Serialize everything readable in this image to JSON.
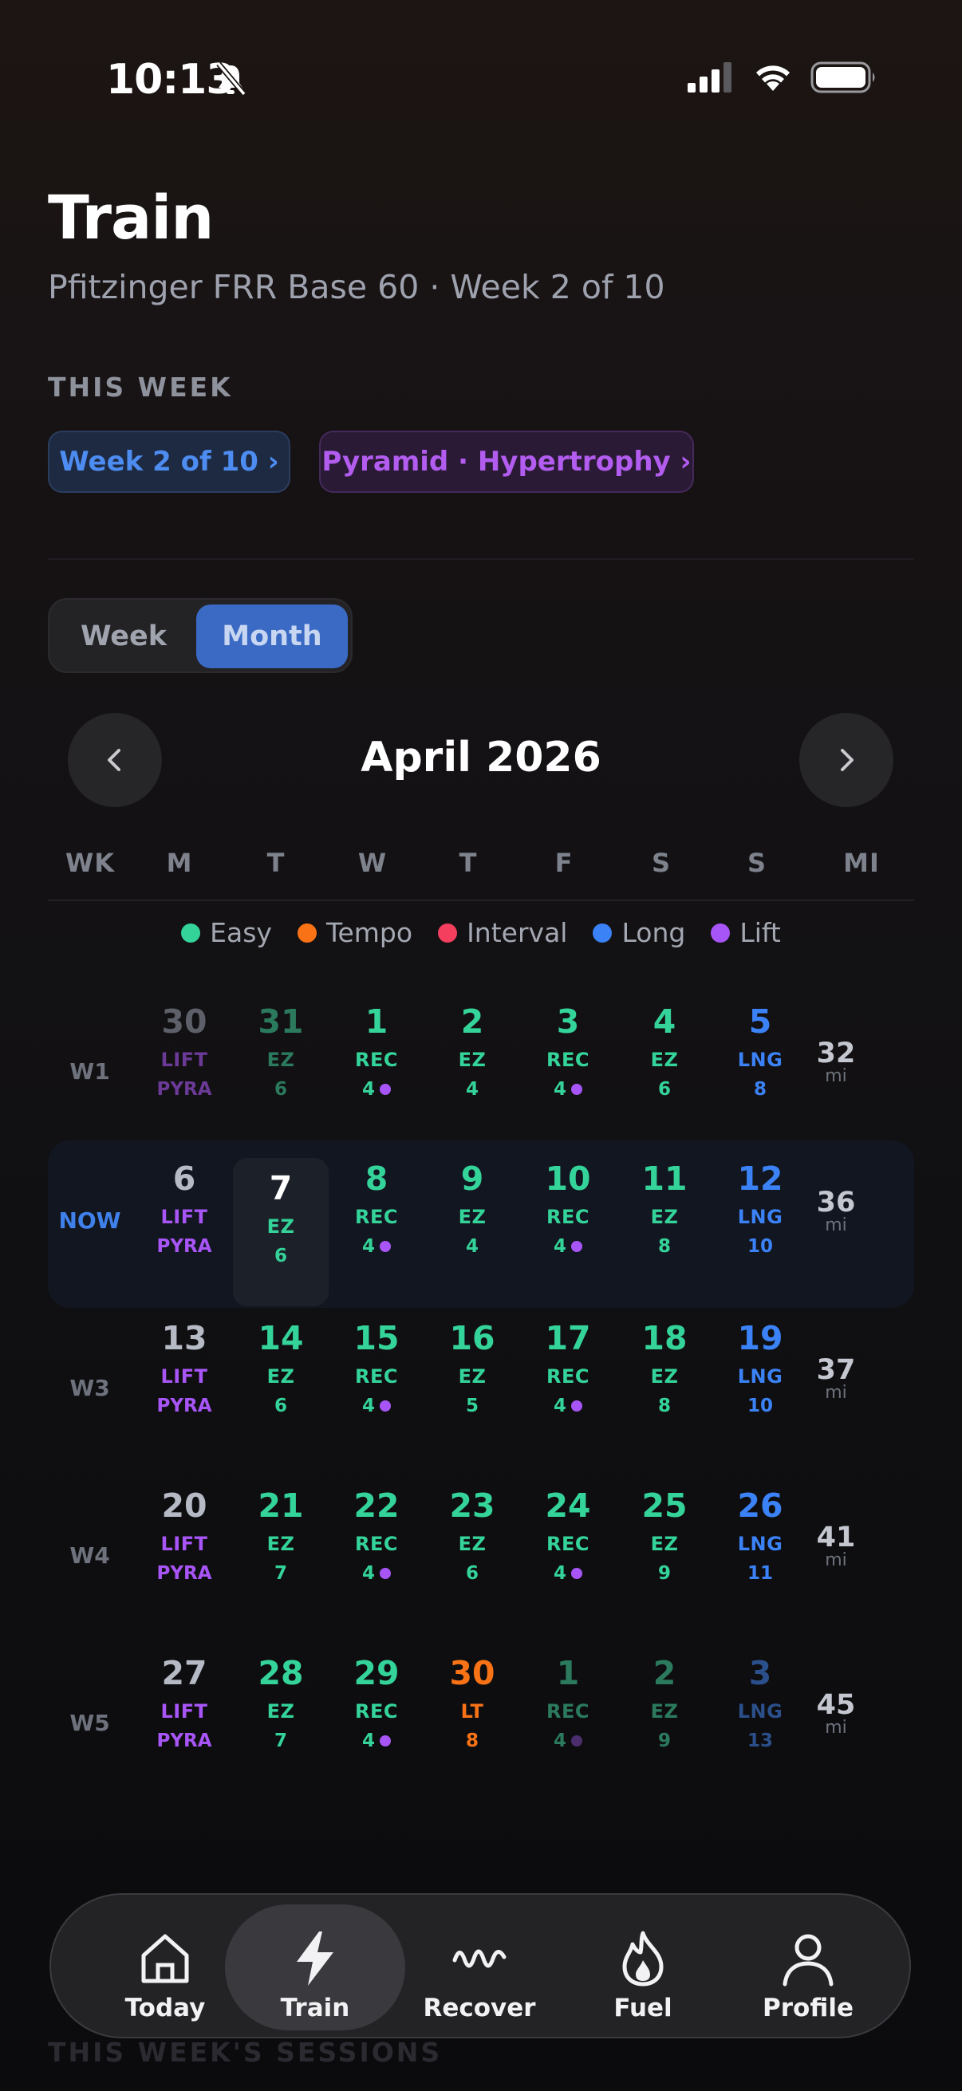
{
  "status_bar": {
    "time": "10:13"
  },
  "header": {
    "title": "Train",
    "subtitle": "Pfitzinger FRR Base 60 · Week 2 of 10",
    "section_label": "THIS WEEK",
    "chip_week": "Week 2 of 10 ›",
    "chip_plan": "Pyramid · Hypertrophy ›"
  },
  "view_toggle": {
    "week_label": "Week",
    "month_label": "Month",
    "selected": "Month"
  },
  "calendar": {
    "month_title": "April 2026",
    "weekday_headers": [
      "WK",
      "M",
      "T",
      "W",
      "T",
      "F",
      "S",
      "S",
      "MI"
    ],
    "legend": [
      {
        "label": "Easy",
        "color": "#34d399"
      },
      {
        "label": "Tempo",
        "color": "#f97316"
      },
      {
        "label": "Interval",
        "color": "#f43f5e"
      },
      {
        "label": "Long",
        "color": "#3b82f6"
      },
      {
        "label": "Lift",
        "color": "#a855f7"
      }
    ],
    "weeks": [
      {
        "label": "W1",
        "miles": "32",
        "miles_unit": "mi",
        "days": [
          {
            "num": "30",
            "type": "LIFT",
            "sub": "PYRA",
            "kind": "lift",
            "dim": true
          },
          {
            "num": "31",
            "type": "EZ",
            "sub": "6",
            "kind": "easy",
            "dim": true
          },
          {
            "num": "1",
            "type": "REC",
            "sub": "4",
            "kind": "easy",
            "dot": true
          },
          {
            "num": "2",
            "type": "EZ",
            "sub": "4",
            "kind": "easy"
          },
          {
            "num": "3",
            "type": "REC",
            "sub": "4",
            "kind": "easy",
            "dot": true
          },
          {
            "num": "4",
            "type": "EZ",
            "sub": "6",
            "kind": "easy"
          },
          {
            "num": "5",
            "type": "LNG",
            "sub": "8",
            "kind": "long"
          }
        ]
      },
      {
        "label": "NOW",
        "miles": "36",
        "miles_unit": "mi",
        "current": true,
        "days": [
          {
            "num": "6",
            "type": "LIFT",
            "sub": "PYRA",
            "kind": "lift"
          },
          {
            "num": "7",
            "type": "EZ",
            "sub": "6",
            "kind": "easy",
            "today": true
          },
          {
            "num": "8",
            "type": "REC",
            "sub": "4",
            "kind": "easy",
            "dot": true
          },
          {
            "num": "9",
            "type": "EZ",
            "sub": "4",
            "kind": "easy"
          },
          {
            "num": "10",
            "type": "REC",
            "sub": "4",
            "kind": "easy",
            "dot": true
          },
          {
            "num": "11",
            "type": "EZ",
            "sub": "8",
            "kind": "easy"
          },
          {
            "num": "12",
            "type": "LNG",
            "sub": "10",
            "kind": "long"
          }
        ]
      },
      {
        "label": "W3",
        "miles": "37",
        "miles_unit": "mi",
        "days": [
          {
            "num": "13",
            "type": "LIFT",
            "sub": "PYRA",
            "kind": "lift"
          },
          {
            "num": "14",
            "type": "EZ",
            "sub": "6",
            "kind": "easy"
          },
          {
            "num": "15",
            "type": "REC",
            "sub": "4",
            "kind": "easy",
            "dot": true
          },
          {
            "num": "16",
            "type": "EZ",
            "sub": "5",
            "kind": "easy"
          },
          {
            "num": "17",
            "type": "REC",
            "sub": "4",
            "kind": "easy",
            "dot": true
          },
          {
            "num": "18",
            "type": "EZ",
            "sub": "8",
            "kind": "easy"
          },
          {
            "num": "19",
            "type": "LNG",
            "sub": "10",
            "kind": "long"
          }
        ]
      },
      {
        "label": "W4",
        "miles": "41",
        "miles_unit": "mi",
        "days": [
          {
            "num": "20",
            "type": "LIFT",
            "sub": "PYRA",
            "kind": "lift"
          },
          {
            "num": "21",
            "type": "EZ",
            "sub": "7",
            "kind": "easy"
          },
          {
            "num": "22",
            "type": "REC",
            "sub": "4",
            "kind": "easy",
            "dot": true
          },
          {
            "num": "23",
            "type": "EZ",
            "sub": "6",
            "kind": "easy"
          },
          {
            "num": "24",
            "type": "REC",
            "sub": "4",
            "kind": "easy",
            "dot": true
          },
          {
            "num": "25",
            "type": "EZ",
            "sub": "9",
            "kind": "easy"
          },
          {
            "num": "26",
            "type": "LNG",
            "sub": "11",
            "kind": "long"
          }
        ]
      },
      {
        "label": "W5",
        "miles": "45",
        "miles_unit": "mi",
        "days": [
          {
            "num": "27",
            "type": "LIFT",
            "sub": "PYRA",
            "kind": "lift"
          },
          {
            "num": "28",
            "type": "EZ",
            "sub": "7",
            "kind": "easy"
          },
          {
            "num": "29",
            "type": "REC",
            "sub": "4",
            "kind": "easy",
            "dot": true
          },
          {
            "num": "30",
            "type": "LT",
            "sub": "8",
            "kind": "tempo"
          },
          {
            "num": "1",
            "type": "REC",
            "sub": "4",
            "kind": "easy",
            "dot": true,
            "dim": true
          },
          {
            "num": "2",
            "type": "EZ",
            "sub": "9",
            "kind": "easy",
            "dim": true
          },
          {
            "num": "3",
            "type": "LNG",
            "sub": "13",
            "kind": "long",
            "dim": true
          }
        ]
      }
    ]
  },
  "section_peek": "THIS WEEK'S SESSIONS",
  "tab_bar": {
    "tabs": [
      {
        "label": "Today",
        "icon": "home-icon"
      },
      {
        "label": "Train",
        "icon": "bolt-icon",
        "active": true
      },
      {
        "label": "Recover",
        "icon": "wave-icon"
      },
      {
        "label": "Fuel",
        "icon": "flame-icon"
      },
      {
        "label": "Profile",
        "icon": "person-icon"
      }
    ]
  },
  "colors": {
    "easy": "#34d399",
    "easy_dim": "#2b7a5e",
    "tempo": "#f97316",
    "long": "#3b82f6",
    "long_dim": "#2b4f8a",
    "lift_num": "#b6bac4",
    "lift_num_dim": "#5d6068",
    "lift_text": "#a855f7",
    "lift_text_dim": "#6b3a96"
  }
}
